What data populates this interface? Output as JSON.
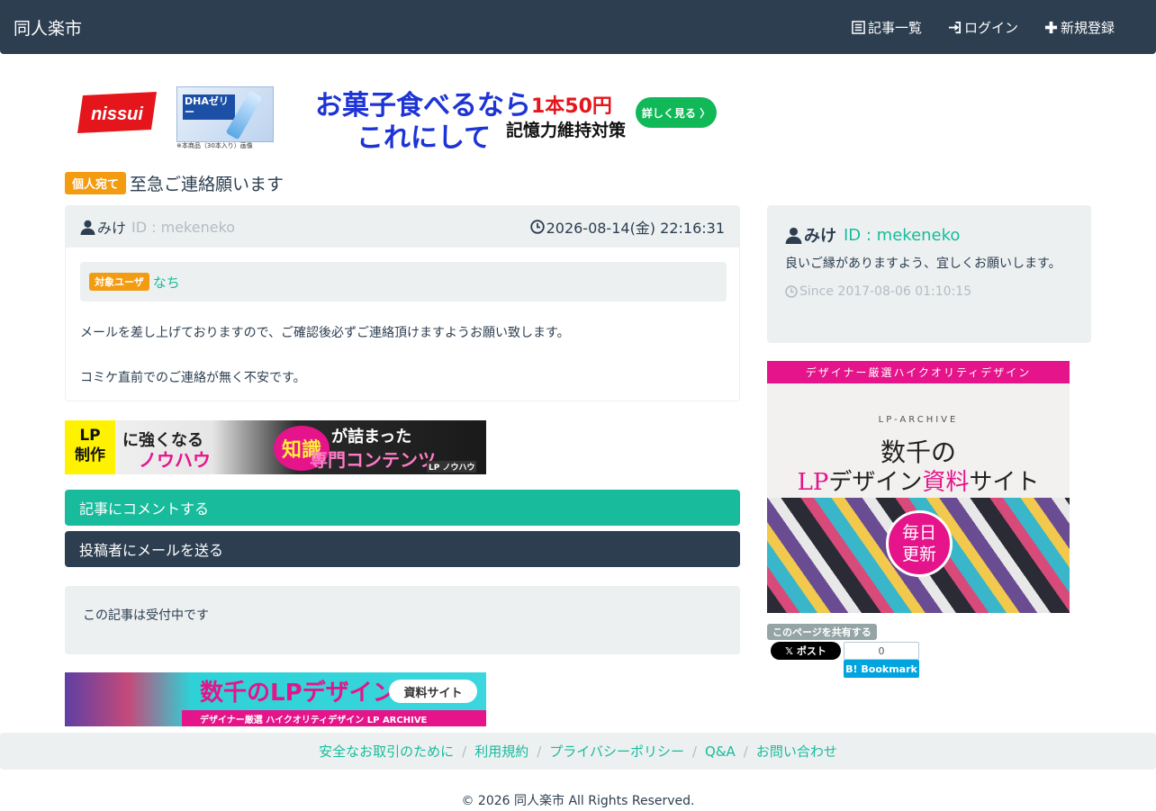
{
  "navbar": {
    "brand": "同人楽市",
    "items": [
      {
        "label": "記事一覧",
        "icon": "list-icon"
      },
      {
        "label": "ログイン",
        "icon": "login-icon"
      },
      {
        "label": "新規登録",
        "icon": "plus-icon"
      }
    ]
  },
  "top_banner": {
    "brand": "nissui",
    "product_label": "DHAゼリー",
    "product_note": "※本商品（30本入り）画像",
    "headline1": "お菓子食べるなら",
    "headline2": "これにして",
    "price": "1本50円",
    "sub": "記憶力維持対策",
    "button": "詳しく見る 〉"
  },
  "article": {
    "badge": "個人宛て",
    "title": "至急ご連絡願います",
    "author": "みけ",
    "author_id": "ID : mekeneko",
    "datetime": "2026-08-14(金) 22:16:31",
    "target_label": "対象ユーザ",
    "target_user": "なち",
    "body": [
      "メールを差し上げておりますので、ご確認後必ずご連絡頂けますようお願い致します。",
      "コミケ直前でのご連絡が無く不安です。"
    ]
  },
  "lp_banner": {
    "left1": "LP",
    "left2": "制作",
    "t1": "に強くなる",
    "t1b": "ノウハウ",
    "circle": "知識",
    "t2": "が詰まった",
    "t3": "専門コンテンツ",
    "logo": "LP ノウハウ"
  },
  "actions": {
    "comment": "記事にコメントする",
    "mail": "投稿者にメールを送る"
  },
  "status": "この記事は受付中です",
  "bottom_banner": {
    "headline": "数千のLPデザイン",
    "pill": "資料サイト",
    "strip": "デザイナー厳選 ハイクオリティデザイン LP ARCHIVE"
  },
  "profile": {
    "name": "みけ",
    "id": "ID : mekeneko",
    "desc": "良いご縁がありますよう、宜しくお願いします。",
    "since": "Since 2017-08-06 01:10:15"
  },
  "side_ad": {
    "top": "デザイナー厳選ハイクオリティデザイン",
    "logo": "LP-ARCHIVE",
    "line1": "数千の",
    "line2a": "LP",
    "line2b": "デザイン",
    "line2c": "資料",
    "line2d": "サイト",
    "badge1": "毎日",
    "badge2": "更新"
  },
  "share": {
    "label": "このページを共有する",
    "x_post": "𝕏 ポスト",
    "hatena_count": "0",
    "hatena_label": "B! Bookmark"
  },
  "footer": {
    "links": [
      "安全なお取引のために",
      "利用規約",
      "プライバシーポリシー",
      "Q&A",
      "お問い合わせ"
    ],
    "copyright": "© 2026 同人楽市 All Rights Reserved."
  },
  "colors": {
    "primary": "#2c3e50",
    "success": "#18bc9c",
    "warning": "#f39c12",
    "light": "#ecf0f1"
  }
}
